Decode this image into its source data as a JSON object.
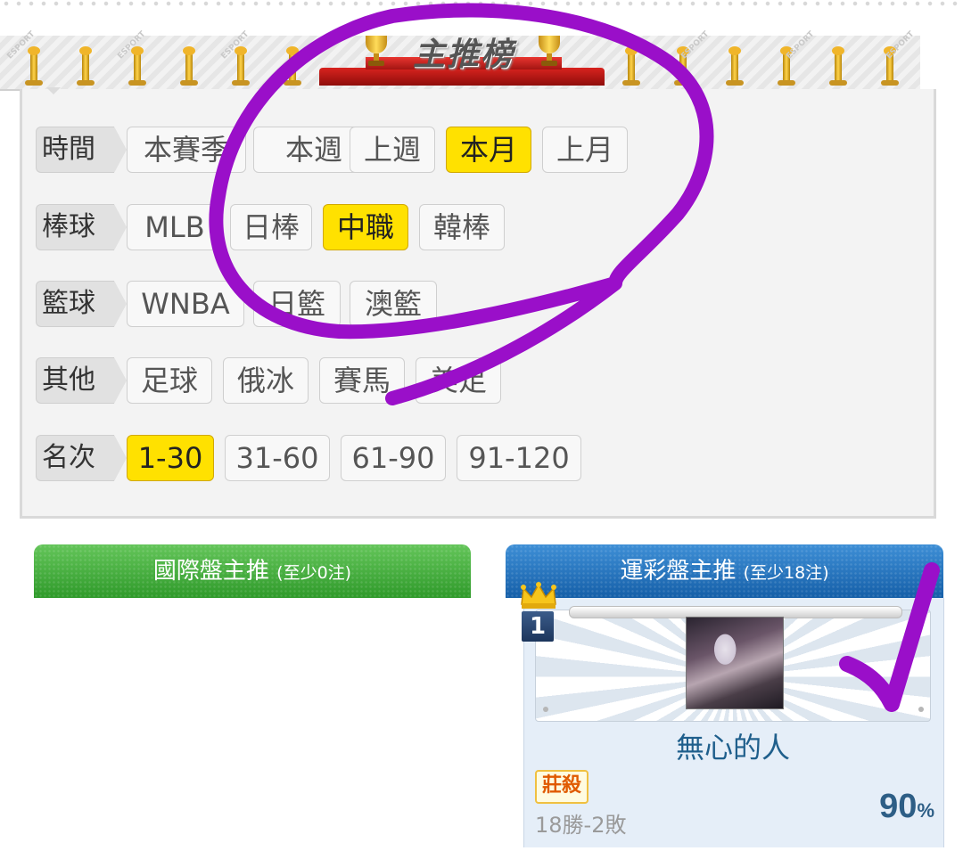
{
  "banner": {
    "title": "主推榜",
    "watermark": "ESPORT"
  },
  "filters": [
    {
      "label": "時間",
      "options": [
        {
          "text": "本賽季",
          "selected": false
        },
        {
          "text": "本週",
          "selected": false
        },
        {
          "text": "上週",
          "selected": false
        },
        {
          "text": "本月",
          "selected": true
        },
        {
          "text": "上月",
          "selected": false
        }
      ]
    },
    {
      "label": "棒球",
      "options": [
        {
          "text": "MLB",
          "selected": false
        },
        {
          "text": "日棒",
          "selected": false
        },
        {
          "text": "中職",
          "selected": true
        },
        {
          "text": "韓棒",
          "selected": false
        }
      ]
    },
    {
      "label": "籃球",
      "options": [
        {
          "text": "WNBA",
          "selected": false
        },
        {
          "text": "日籃",
          "selected": false
        },
        {
          "text": "澳籃",
          "selected": false
        }
      ]
    },
    {
      "label": "其他",
      "options": [
        {
          "text": "足球",
          "selected": false
        },
        {
          "text": "俄冰",
          "selected": false
        },
        {
          "text": "賽馬",
          "selected": false
        },
        {
          "text": "美足",
          "selected": false
        }
      ]
    },
    {
      "label": "名次",
      "options": [
        {
          "text": "1-30",
          "selected": true
        },
        {
          "text": "31-60",
          "selected": false
        },
        {
          "text": "61-90",
          "selected": false
        },
        {
          "text": "91-120",
          "selected": false
        }
      ]
    }
  ],
  "sections": {
    "international": {
      "title": "國際盤主推",
      "note": "(至少0注)"
    },
    "sports_lottery": {
      "title": "運彩盤主推",
      "note": "(至少18注)"
    }
  },
  "top_user": {
    "rank": "1",
    "name": "無心的人",
    "tag": "莊殺",
    "record": "18勝-2敗",
    "win_rate": "90",
    "win_rate_unit": "%"
  },
  "colors": {
    "selected": "#ffe100",
    "green_header": "#2f9a2a",
    "blue_header": "#155fa8",
    "annotation": "#9a0fc9"
  },
  "icons": [
    "trophy-icon",
    "crown-icon",
    "rank-badge",
    "check-mark-annotation",
    "circle-annotation"
  ]
}
